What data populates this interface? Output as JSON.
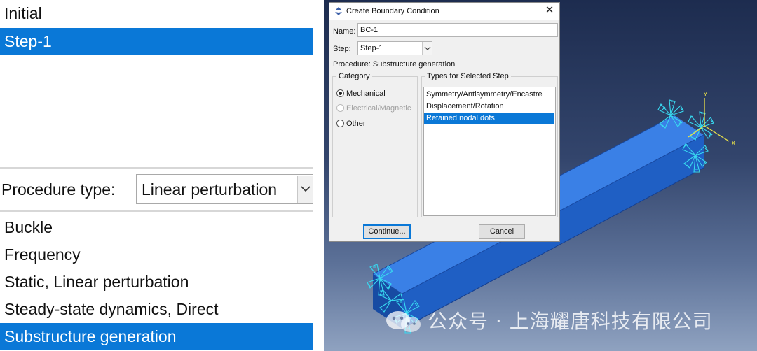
{
  "left_panel": {
    "steps": [
      {
        "label": "Initial",
        "selected": false
      },
      {
        "label": "Step-1",
        "selected": true
      }
    ],
    "procedure_type_label": "Procedure type:",
    "procedure_type_value": "Linear perturbation",
    "procedures": [
      {
        "label": "Buckle",
        "selected": false
      },
      {
        "label": "Frequency",
        "selected": false
      },
      {
        "label": "Static, Linear perturbation",
        "selected": false
      },
      {
        "label": "Steady-state dynamics, Direct",
        "selected": false
      },
      {
        "label": "Substructure generation",
        "selected": true
      }
    ]
  },
  "dialog": {
    "title": "Create Boundary Condition",
    "title_icon": "boundary-condition-icon",
    "close_glyph": "✕",
    "name_label": "Name:",
    "name_value": "BC-1",
    "step_label": "Step:",
    "step_value": "Step-1",
    "procedure_line": "Procedure:  Substructure generation",
    "category_title": "Category",
    "categories": [
      {
        "label": "Mechanical",
        "checked": true,
        "enabled": true
      },
      {
        "label": "Electrical/Magnetic",
        "checked": false,
        "enabled": false
      },
      {
        "label": "Other",
        "checked": false,
        "enabled": true
      }
    ],
    "types_title": "Types for Selected Step",
    "types": [
      {
        "label": "Symmetry/Antisymmetry/Encastre",
        "selected": false
      },
      {
        "label": "Displacement/Rotation",
        "selected": false
      },
      {
        "label": "Retained nodal dofs",
        "selected": true
      }
    ],
    "continue_label": "Continue...",
    "cancel_label": "Cancel"
  },
  "viewport": {
    "axis_labels": {
      "y": "Y",
      "x": "X"
    },
    "beam_color": "#2f6fd6",
    "bc_symbol_color": "#38d8f0"
  },
  "watermark": {
    "text": "公众号 · 上海耀唐科技有限公司",
    "icon": "wechat-icon"
  },
  "colors": {
    "selection": "#0a78d7",
    "dialog_bg": "#f0f0f0"
  }
}
